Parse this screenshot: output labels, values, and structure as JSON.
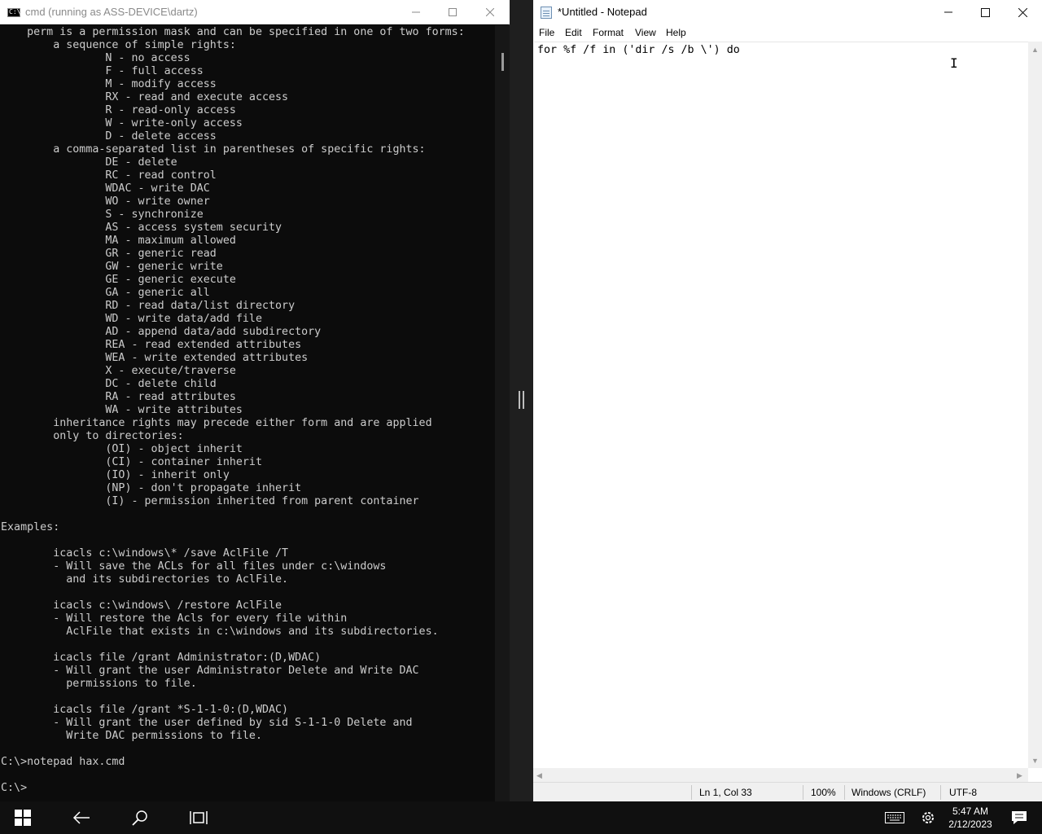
{
  "cmd": {
    "title": "cmd (running as ASS-DEVICE\\dartz)",
    "icon": "C:\\",
    "lines": [
      "    perm is a permission mask and can be specified in one of two forms:",
      "        a sequence of simple rights:",
      "                N - no access",
      "                F - full access",
      "                M - modify access",
      "                RX - read and execute access",
      "                R - read-only access",
      "                W - write-only access",
      "                D - delete access",
      "        a comma-separated list in parentheses of specific rights:",
      "                DE - delete",
      "                RC - read control",
      "                WDAC - write DAC",
      "                WO - write owner",
      "                S - synchronize",
      "                AS - access system security",
      "                MA - maximum allowed",
      "                GR - generic read",
      "                GW - generic write",
      "                GE - generic execute",
      "                GA - generic all",
      "                RD - read data/list directory",
      "                WD - write data/add file",
      "                AD - append data/add subdirectory",
      "                REA - read extended attributes",
      "                WEA - write extended attributes",
      "                X - execute/traverse",
      "                DC - delete child",
      "                RA - read attributes",
      "                WA - write attributes",
      "        inheritance rights may precede either form and are applied",
      "        only to directories:",
      "                (OI) - object inherit",
      "                (CI) - container inherit",
      "                (IO) - inherit only",
      "                (NP) - don't propagate inherit",
      "                (I) - permission inherited from parent container",
      "",
      "Examples:",
      "",
      "        icacls c:\\windows\\* /save AclFile /T",
      "        - Will save the ACLs for all files under c:\\windows",
      "          and its subdirectories to AclFile.",
      "",
      "        icacls c:\\windows\\ /restore AclFile",
      "        - Will restore the Acls for every file within",
      "          AclFile that exists in c:\\windows and its subdirectories.",
      "",
      "        icacls file /grant Administrator:(D,WDAC)",
      "        - Will grant the user Administrator Delete and Write DAC",
      "          permissions to file.",
      "",
      "        icacls file /grant *S-1-1-0:(D,WDAC)",
      "        - Will grant the user defined by sid S-1-1-0 Delete and",
      "          Write DAC permissions to file.",
      "",
      "C:\\>notepad hax.cmd",
      "",
      "C:\\>"
    ]
  },
  "notepad": {
    "title": "*Untitled - Notepad",
    "menu": [
      "File",
      "Edit",
      "Format",
      "View",
      "Help"
    ],
    "content": "for %f /f in ('dir /s /b \\') do",
    "status": {
      "position": "Ln 1, Col 33",
      "zoom": "100%",
      "line_ending": "Windows (CRLF)",
      "encoding": "UTF-8"
    }
  },
  "taskbar": {
    "time": "5:47 AM",
    "date": "2/12/2023",
    "icons": [
      "windows-start-icon",
      "back-icon",
      "search-icon",
      "task-view-icon",
      "keyboard-icon",
      "gear-icon",
      "notification-icon"
    ]
  }
}
